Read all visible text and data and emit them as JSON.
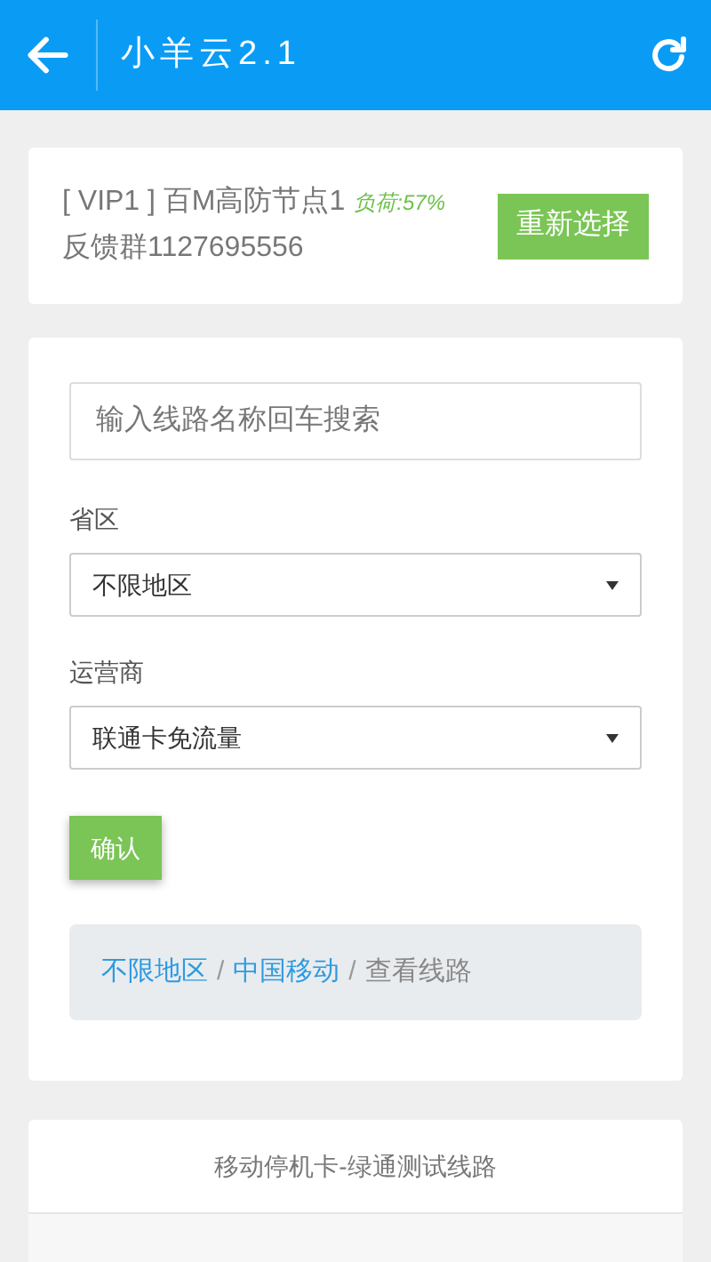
{
  "header": {
    "title": "小羊云2.1"
  },
  "node_card": {
    "node": "[ VIP1 ] 百M高防节点1",
    "load": "负荷:57%",
    "feedback": "反馈群1127695556",
    "reselect_button": "重新选择"
  },
  "filter_card": {
    "search": {
      "placeholder": "输入线路名称回车搜索"
    },
    "fields": [
      {
        "label": "省区",
        "value": "不限地区"
      },
      {
        "label": "运营商",
        "value": "联通卡免流量"
      }
    ],
    "confirm_button": "确认",
    "breadcrumb": [
      {
        "label": "不限地区",
        "kind": "link"
      },
      {
        "label": "/",
        "kind": "separator"
      },
      {
        "label": "中国移动",
        "kind": "link"
      },
      {
        "label": "/",
        "kind": "separator"
      },
      {
        "label": "查看线路",
        "kind": "current"
      }
    ]
  },
  "line_card": {
    "title": "移动停机卡-绿通测试线路"
  }
}
